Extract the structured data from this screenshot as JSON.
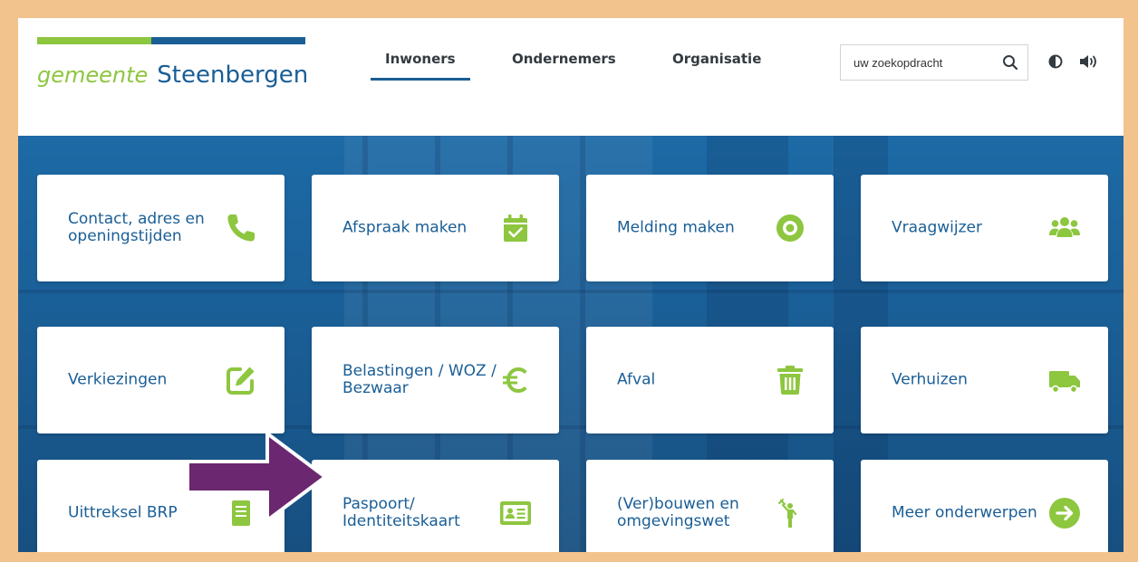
{
  "logo": {
    "part1": "gemeente",
    "part2": "Steenbergen"
  },
  "nav": [
    {
      "label": "Inwoners",
      "active": true
    },
    {
      "label": "Ondernemers",
      "active": false
    },
    {
      "label": "Organisatie",
      "active": false
    }
  ],
  "search": {
    "placeholder": "uw zoekopdracht",
    "icon": "search-icon"
  },
  "toolbar": {
    "contrast_icon": "contrast-icon",
    "speaker_icon": "speaker-icon"
  },
  "colors": {
    "brand_green": "#8dc63f",
    "brand_blue": "#1a5e96",
    "frame": "#f3c38e",
    "arrow": "#6b2770"
  },
  "tiles": [
    {
      "label": "Contact, adres en openingstijden",
      "icon": "phone-icon"
    },
    {
      "label": "Afspraak maken",
      "icon": "calendar-check-icon"
    },
    {
      "label": "Melding maken",
      "icon": "eye-icon"
    },
    {
      "label": "Vraagwijzer",
      "icon": "users-icon"
    },
    {
      "label": "Verkiezingen",
      "icon": "edit-icon"
    },
    {
      "label": "Belastingen / WOZ / Bezwaar",
      "icon": "euro-icon"
    },
    {
      "label": "Afval",
      "icon": "trash-icon"
    },
    {
      "label": "Verhuizen",
      "icon": "truck-icon"
    },
    {
      "label": "Uittreksel BRP",
      "icon": "document-icon"
    },
    {
      "label": "Paspoort/ Identiteitskaart",
      "icon": "id-card-icon"
    },
    {
      "label": "(Ver)bouwen en omgevingswet",
      "icon": "builder-icon"
    },
    {
      "label": "Meer onderwerpen",
      "icon": "arrow-circle-right-icon"
    }
  ]
}
